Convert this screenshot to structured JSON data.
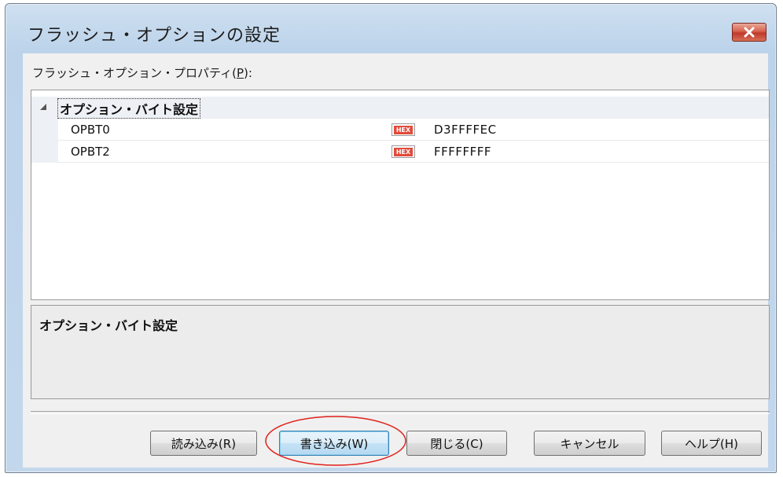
{
  "window": {
    "title": "フラッシュ・オプションの設定",
    "close_glyph": "✕"
  },
  "properties": {
    "label_prefix": "フラッシュ・オプション・プロパティ(",
    "label_key": "P",
    "label_suffix": "):",
    "category": "オプション・バイト設定",
    "rows": [
      {
        "name": "OPBT0",
        "badge": "HEX",
        "value": "D3FFFFEC"
      },
      {
        "name": "OPBT2",
        "badge": "HEX",
        "value": "FFFFFFFF"
      }
    ]
  },
  "description": {
    "title": "オプション・バイト設定"
  },
  "buttons": {
    "read": "読み込み(R)",
    "write": "書き込み(W)",
    "close": "閉じる(C)",
    "cancel": "キャンセル",
    "help": "ヘルプ(H)"
  },
  "colors": {
    "highlight_ellipse": "#e0201a",
    "hex_badge": "#e24a3b"
  }
}
